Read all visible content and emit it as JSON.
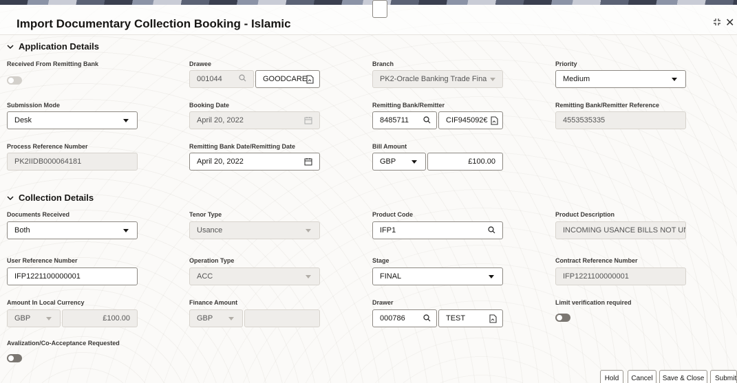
{
  "window": {
    "title": "Import Documentary Collection Booking - Islamic"
  },
  "sections": {
    "application": "Application Details",
    "collection": "Collection Details"
  },
  "fields": {
    "received_from_remitting_bank": {
      "label": "Received From Remitting Bank"
    },
    "drawee": {
      "label": "Drawee",
      "id": "001044",
      "name": "GOODCARE"
    },
    "branch": {
      "label": "Branch",
      "value": "PK2-Oracle Banking Trade Fina"
    },
    "priority": {
      "label": "Priority",
      "value": "Medium"
    },
    "submission_mode": {
      "label": "Submission Mode",
      "value": "Desk"
    },
    "booking_date": {
      "label": "Booking Date",
      "value": "April 20, 2022"
    },
    "remitting_bank": {
      "label": "Remitting Bank/Remitter",
      "id": "8485711",
      "name": "CIF945092€"
    },
    "remitting_bank_ref": {
      "label": "Remitting Bank/Remitter Reference",
      "value": "4553535335"
    },
    "process_ref": {
      "label": "Process Reference Number",
      "value": "PK2IIDB000064181"
    },
    "remitting_bank_date": {
      "label": "Remitting Bank Date/Remitting Date",
      "value": "April 20, 2022"
    },
    "bill_amount": {
      "label": "Bill Amount",
      "currency": "GBP",
      "value": "£100.00"
    },
    "documents_received": {
      "label": "Documents Received",
      "value": "Both"
    },
    "tenor_type": {
      "label": "Tenor Type",
      "value": "Usance"
    },
    "product_code": {
      "label": "Product Code",
      "value": "IFP1"
    },
    "product_description": {
      "label": "Product Description",
      "value": "INCOMING USANCE BILLS NOT UN"
    },
    "user_ref": {
      "label": "User Reference Number",
      "value": "IFP1221100000001"
    },
    "operation_type": {
      "label": "Operation Type",
      "value": "ACC"
    },
    "stage": {
      "label": "Stage",
      "value": "FINAL"
    },
    "contract_ref": {
      "label": "Contract Reference Number",
      "value": "IFP1221100000001"
    },
    "amount_local": {
      "label": "Amount In Local Currency",
      "currency": "GBP",
      "value": "£100.00"
    },
    "finance_amount": {
      "label": "Finance Amount",
      "currency": "GBP",
      "value": ""
    },
    "drawer": {
      "label": "Drawer",
      "id": "000786",
      "name": "TEST"
    },
    "limit_verification": {
      "label": "Limit verification required"
    },
    "avalization": {
      "label": "Avalization/Co-Acceptance Requested"
    }
  },
  "buttons": {
    "hold": "Hold",
    "cancel": "Cancel",
    "save_close": "Save & Close",
    "submit": "Submit"
  },
  "icons": [
    "chevron-down-icon",
    "search-icon",
    "lookup-icon",
    "calendar-icon",
    "minimize-icon",
    "close-icon"
  ]
}
